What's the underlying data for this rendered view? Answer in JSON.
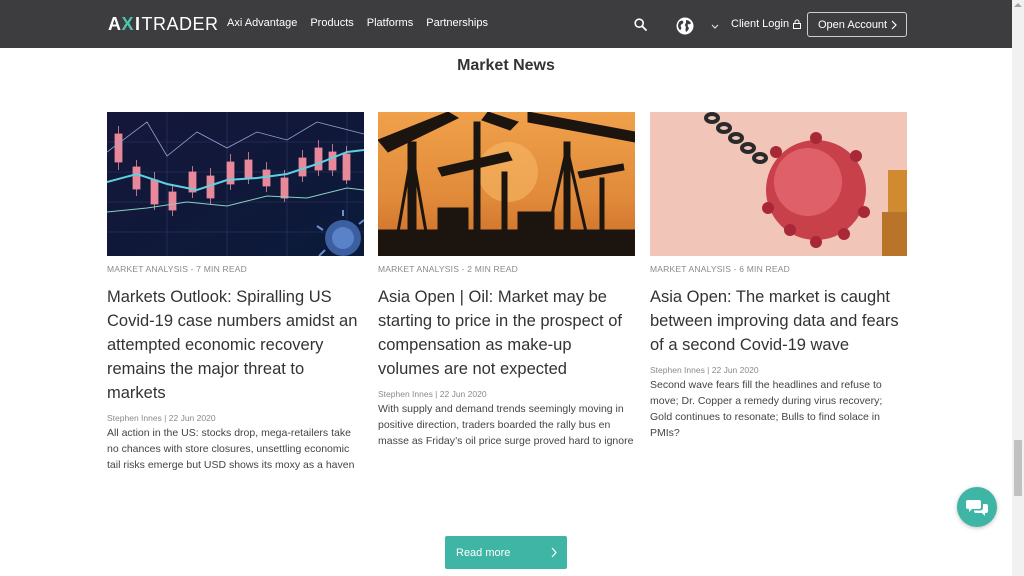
{
  "header": {
    "logo": {
      "part1": "A",
      "part2": "X",
      "part3": "I",
      "part4": "TRADER"
    },
    "nav": [
      "Axi Advantage",
      "Products",
      "Platforms",
      "Partnerships"
    ],
    "client_login": "Client Login",
    "open_account": "Open Account"
  },
  "section": {
    "title": "Market News"
  },
  "articles": [
    {
      "category": "MARKET ANALYSIS - 7 MIN READ",
      "headline": "Markets Outlook: Spiralling US Covid-19 case numbers amidst an attempted economic recovery remains the major threat to markets",
      "meta": "Stephen Innes | 22 Jun 2020",
      "summary": "All action in the US: stocks drop, mega-retailers take no chances with store closures, unsettling economic tail risks emerge but USD shows its moxy as a haven"
    },
    {
      "category": "MARKET ANALYSIS - 2 MIN READ",
      "headline": "Asia Open | Oil: Market may be starting to price in the prospect of compensation as make-up volumes are not expected",
      "meta": "Stephen Innes | 22 Jun 2020",
      "summary": "With supply and demand trends seemingly moving in positive direction, traders boarded the rally bus en masse as Friday’s oil price surge proved hard to ignore"
    },
    {
      "category": "MARKET ANALYSIS - 6 MIN READ",
      "headline": "Asia Open: The market is caught between improving data and fears of a second Covid-19 wave",
      "meta": "Stephen Innes | 22 Jun 2020",
      "summary": "Second wave fears fill the headlines and refuse to move; Dr. Copper a remedy during virus recovery; Gold continues to resonate; Bulls to find solace in PMIs?"
    }
  ],
  "read_more": "Read more",
  "colors": {
    "header_bg": "#3d3d40",
    "accent": "#3fb5a5"
  }
}
